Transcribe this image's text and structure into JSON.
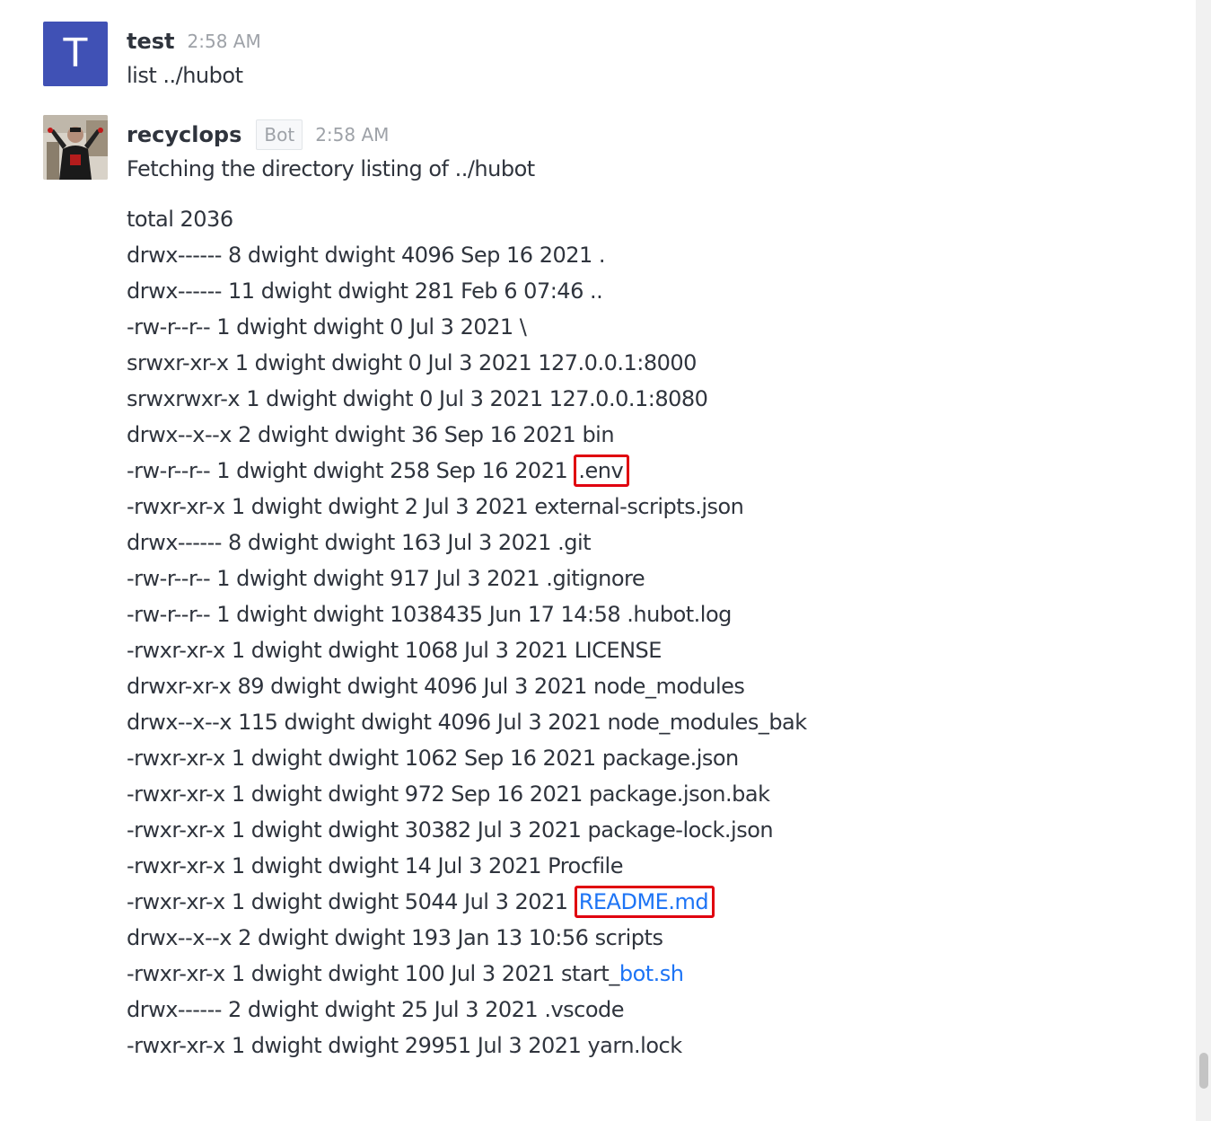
{
  "messages": [
    {
      "avatar_letter": "T",
      "username": "test",
      "time": "2:58 AM",
      "text": "list ../hubot"
    },
    {
      "username": "recyclops",
      "badge": "Bot",
      "time": "2:58 AM",
      "text": "Fetching the directory listing of ../hubot",
      "listing": {
        "total": "total 2036",
        "lines": [
          {
            "prefix": "drwx------ 8 dwight dwight 4096 Sep 16 2021 ."
          },
          {
            "prefix": "drwx------ 11 dwight dwight 281 Feb 6 07:46 .."
          },
          {
            "prefix": "-rw-r--r-- 1 dwight dwight 0 Jul 3 2021 \\"
          },
          {
            "prefix": "srwxr-xr-x 1 dwight dwight 0 Jul 3 2021 127.0.0.1:8000"
          },
          {
            "prefix": "srwxrwxr-x 1 dwight dwight 0 Jul 3 2021 127.0.0.1:8080"
          },
          {
            "prefix": "drwx--x--x 2 dwight dwight 36 Sep 16 2021 bin"
          },
          {
            "prefix": "-rw-r--r-- 1 dwight dwight 258 Sep 16 2021 ",
            "highlight": ".env"
          },
          {
            "prefix": "-rwxr-xr-x 1 dwight dwight 2 Jul 3 2021 external-scripts.json"
          },
          {
            "prefix": "drwx------ 8 dwight dwight 163 Jul 3 2021 .git"
          },
          {
            "prefix": "-rw-r--r-- 1 dwight dwight 917 Jul 3 2021 .gitignore"
          },
          {
            "prefix": "-rw-r--r-- 1 dwight dwight 1038435 Jun 17 14:58 .hubot.log"
          },
          {
            "prefix": "-rwxr-xr-x 1 dwight dwight 1068 Jul 3 2021 LICENSE"
          },
          {
            "prefix": "drwxr-xr-x 89 dwight dwight 4096 Jul 3 2021 node_modules"
          },
          {
            "prefix": "drwx--x--x 115 dwight dwight 4096 Jul 3 2021 node_modules_bak"
          },
          {
            "prefix": "-rwxr-xr-x 1 dwight dwight 1062 Sep 16 2021 package.json"
          },
          {
            "prefix": "-rwxr-xr-x 1 dwight dwight 972 Sep 16 2021 package.json.bak"
          },
          {
            "prefix": "-rwxr-xr-x 1 dwight dwight 30382 Jul 3 2021 package-lock.json"
          },
          {
            "prefix": "-rwxr-xr-x 1 dwight dwight 14 Jul 3 2021 Procfile"
          },
          {
            "prefix": "-rwxr-xr-x 1 dwight dwight 5044 Jul 3 2021 ",
            "highlight_link": "README.md"
          },
          {
            "prefix": "drwx--x--x 2 dwight dwight 193 Jan 13 10:56 scripts"
          },
          {
            "prefix": "-rwxr-xr-x 1 dwight dwight 100 Jul 3 2021 start_",
            "link": "bot.sh"
          },
          {
            "prefix": "drwx------ 2 dwight dwight 25 Jul 3 2021 .vscode"
          },
          {
            "prefix": "-rwxr-xr-x 1 dwight dwight 29951 Jul 3 2021 yarn.lock"
          }
        ]
      }
    }
  ],
  "colors": {
    "avatar_bg": "#4051b5",
    "link": "#1d74f5",
    "highlight_border": "#e0000f",
    "timestamp": "#9ea2a8"
  },
  "icons": {
    "bot_avatar": "user-photo-avatar"
  }
}
